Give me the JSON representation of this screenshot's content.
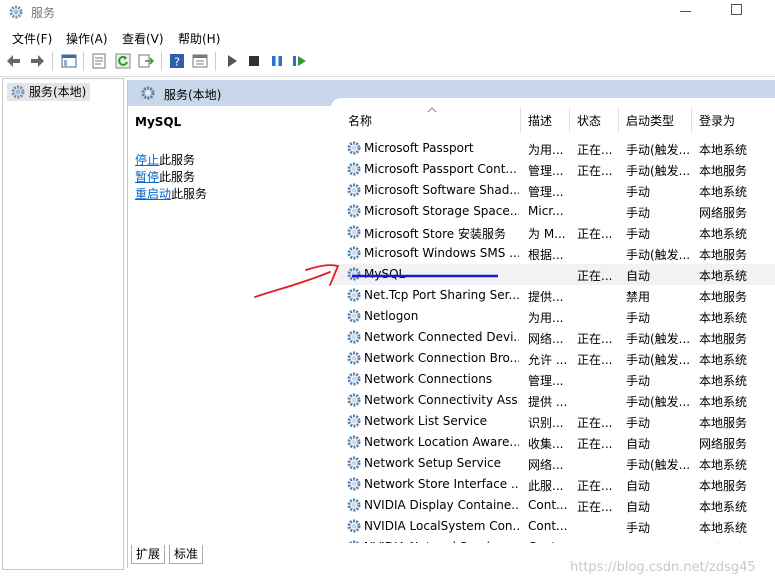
{
  "window": {
    "title": "服务"
  },
  "menu": [
    "文件(F)",
    "操作(A)",
    "查看(V)",
    "帮助(H)"
  ],
  "toolbar_icons": [
    "back-arrow-icon",
    "forward-arrow-icon",
    "console-tree-icon",
    "properties-icon",
    "refresh-icon",
    "export-icon",
    "help-icon",
    "console-view-icon",
    "start-service-icon",
    "stop-service-icon",
    "pause-service-icon",
    "restart-service-icon"
  ],
  "tree": {
    "root": "服务(本地)"
  },
  "pane": {
    "header": "服务(本地)"
  },
  "detail": {
    "name": "MySQL",
    "stop_link": "停止",
    "stop_suffix": "此服务",
    "pause_link": "暂停",
    "pause_suffix": "此服务",
    "restart_link": "重启动",
    "restart_suffix": "此服务"
  },
  "columns": [
    "名称",
    "描述",
    "状态",
    "启动类型",
    "登录为"
  ],
  "services": [
    {
      "name": "Microsoft Passport",
      "desc": "为用...",
      "state": "正在...",
      "start": "手动(触发...",
      "logon": "本地系统"
    },
    {
      "name": "Microsoft Passport Cont...",
      "desc": "管理...",
      "state": "正在...",
      "start": "手动(触发...",
      "logon": "本地服务"
    },
    {
      "name": "Microsoft Software Shad...",
      "desc": "管理...",
      "state": "",
      "start": "手动",
      "logon": "本地系统"
    },
    {
      "name": "Microsoft Storage Space...",
      "desc": "Micr...",
      "state": "",
      "start": "手动",
      "logon": "网络服务"
    },
    {
      "name": "Microsoft Store 安装服务",
      "desc": "为 M...",
      "state": "正在...",
      "start": "手动",
      "logon": "本地系统"
    },
    {
      "name": "Microsoft Windows SMS ...",
      "desc": "根据...",
      "state": "",
      "start": "手动(触发...",
      "logon": "本地服务"
    },
    {
      "name": "MySQL",
      "desc": "",
      "state": "正在...",
      "start": "自动",
      "logon": "本地系统"
    },
    {
      "name": "Net.Tcp Port Sharing Ser...",
      "desc": "提供...",
      "state": "",
      "start": "禁用",
      "logon": "本地服务"
    },
    {
      "name": "Netlogon",
      "desc": "为用...",
      "state": "",
      "start": "手动",
      "logon": "本地系统"
    },
    {
      "name": "Network Connected Devi...",
      "desc": "网络...",
      "state": "正在...",
      "start": "手动(触发...",
      "logon": "本地服务"
    },
    {
      "name": "Network Connection Bro...",
      "desc": "允许 ...",
      "state": "正在...",
      "start": "手动(触发...",
      "logon": "本地系统"
    },
    {
      "name": "Network Connections",
      "desc": "管理...",
      "state": "",
      "start": "手动",
      "logon": "本地系统"
    },
    {
      "name": "Network Connectivity Ass...",
      "desc": "提供 ...",
      "state": "",
      "start": "手动(触发...",
      "logon": "本地系统"
    },
    {
      "name": "Network List Service",
      "desc": "识别...",
      "state": "正在...",
      "start": "手动",
      "logon": "本地服务"
    },
    {
      "name": "Network Location Aware...",
      "desc": "收集...",
      "state": "正在...",
      "start": "自动",
      "logon": "网络服务"
    },
    {
      "name": "Network Setup Service",
      "desc": "网络...",
      "state": "",
      "start": "手动(触发...",
      "logon": "本地系统"
    },
    {
      "name": "Network Store Interface ...",
      "desc": "此服...",
      "state": "正在...",
      "start": "自动",
      "logon": "本地服务"
    },
    {
      "name": "NVIDIA Display Containe...",
      "desc": "Cont...",
      "state": "正在...",
      "start": "自动",
      "logon": "本地系统"
    },
    {
      "name": "NVIDIA LocalSystem Con...",
      "desc": "Cont...",
      "state": "",
      "start": "手动",
      "logon": "本地系统"
    },
    {
      "name": "NVIDIA NetworkService ...",
      "desc": "Cont...",
      "state": "",
      "start": "手动",
      "logon": "网络服务"
    }
  ],
  "selected_service": "MySQL",
  "tabs": [
    "扩展",
    "标准"
  ],
  "watermark": "https://blog.csdn.net/zdsg45",
  "colors": {
    "header_band": "#c7d6e8",
    "link": "#0066cc",
    "red_annotation": "#e02020",
    "blue_underline": "#1a1ad6"
  }
}
